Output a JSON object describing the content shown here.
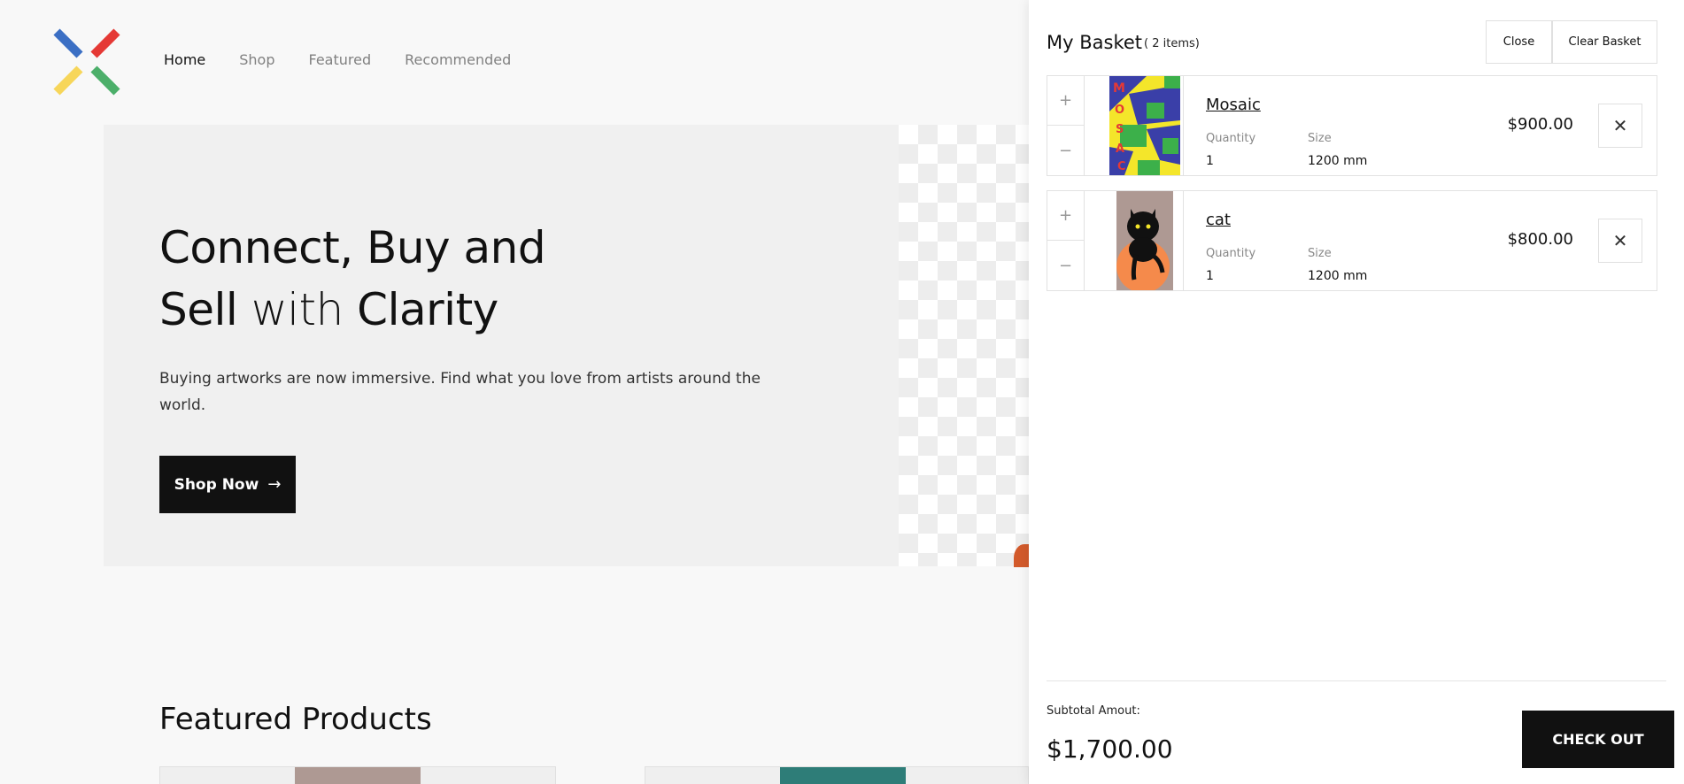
{
  "nav": {
    "items": [
      {
        "label": "Home",
        "active": true
      },
      {
        "label": "Shop",
        "active": false
      },
      {
        "label": "Featured",
        "active": false
      },
      {
        "label": "Recommended",
        "active": false
      }
    ]
  },
  "hero": {
    "title_line1": "Connect, Buy and",
    "title_line2_bold1": "Sell",
    "title_line2_light": " with ",
    "title_line2_bold2": "Clarity",
    "subtitle": "Buying artworks are now immersive. Find what you love from artists around the world.",
    "cta_label": "Shop Now",
    "cta_icon": "arrow-right-icon"
  },
  "featured": {
    "title": "Featured Products"
  },
  "basket": {
    "title": "My Basket",
    "count": "( 2 items)",
    "close_label": "Close",
    "clear_label": "Clear Basket",
    "items": [
      {
        "name": "Mosaic",
        "quantity_label": "Quantity",
        "quantity": "1",
        "size_label": "Size",
        "size": "1200 mm",
        "price": "$900.00"
      },
      {
        "name": "cat",
        "quantity_label": "Quantity",
        "quantity": "1",
        "size_label": "Size",
        "size": "1200 mm",
        "price": "$800.00"
      }
    ],
    "subtotal_label": "Subtotal Amout:",
    "subtotal_value": "$1,700.00",
    "checkout_label": "CHECK OUT"
  },
  "colors": {
    "logo_blue": "#3b6fc4",
    "logo_red": "#e53935",
    "logo_yellow": "#f7d65a",
    "logo_green": "#4caf6a",
    "primary_dark": "#111111"
  }
}
